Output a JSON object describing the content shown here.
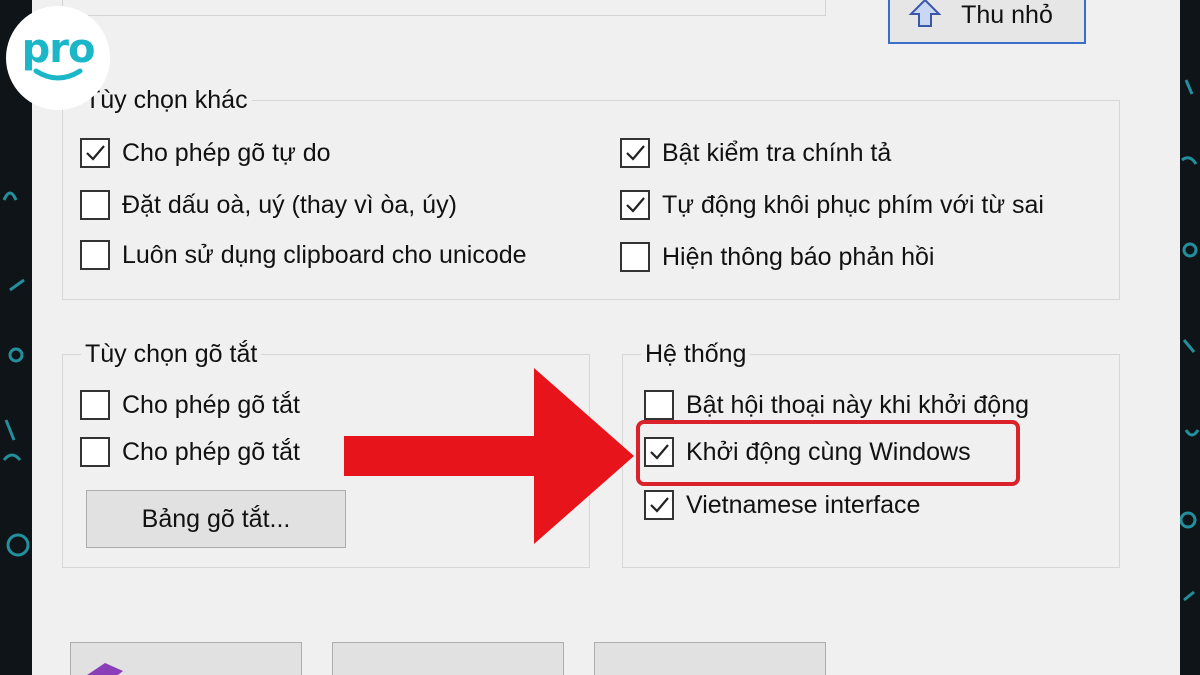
{
  "brand": {
    "logo_text": "pro",
    "logo_color": "#1bb7c9"
  },
  "top": {
    "minimize_label": "Thu nhỏ"
  },
  "other_options": {
    "title": "Tùy chọn khác",
    "left": [
      {
        "label": "Cho phép gõ tự do",
        "checked": true
      },
      {
        "label": "Đặt dấu oà, uý (thay vì òa, úy)",
        "checked": false
      },
      {
        "label": "Luôn sử dụng clipboard cho unicode",
        "checked": false
      }
    ],
    "right": [
      {
        "label": "Bật kiểm tra chính tả",
        "checked": true
      },
      {
        "label": "Tự động khôi phục phím với từ sai",
        "checked": true
      },
      {
        "label": "Hiện thông báo phản hồi",
        "checked": false
      }
    ]
  },
  "shortcut": {
    "title": "Tùy chọn gõ tắt",
    "options": [
      {
        "label": "Cho phép gõ tắt",
        "checked": false
      },
      {
        "label": "Cho phép gõ tắt",
        "checked": false
      }
    ],
    "table_button": "Bảng gõ tắt..."
  },
  "system": {
    "title": "Hệ thống",
    "options": [
      {
        "label": "Bật hội thoại này khi khởi động",
        "checked": false
      },
      {
        "label": "Khởi động cùng Windows",
        "checked": true
      },
      {
        "label": "Vietnamese interface",
        "checked": true
      }
    ]
  },
  "annotation": {
    "highlight_color": "#d9222a",
    "arrow_color": "#e8141b"
  }
}
